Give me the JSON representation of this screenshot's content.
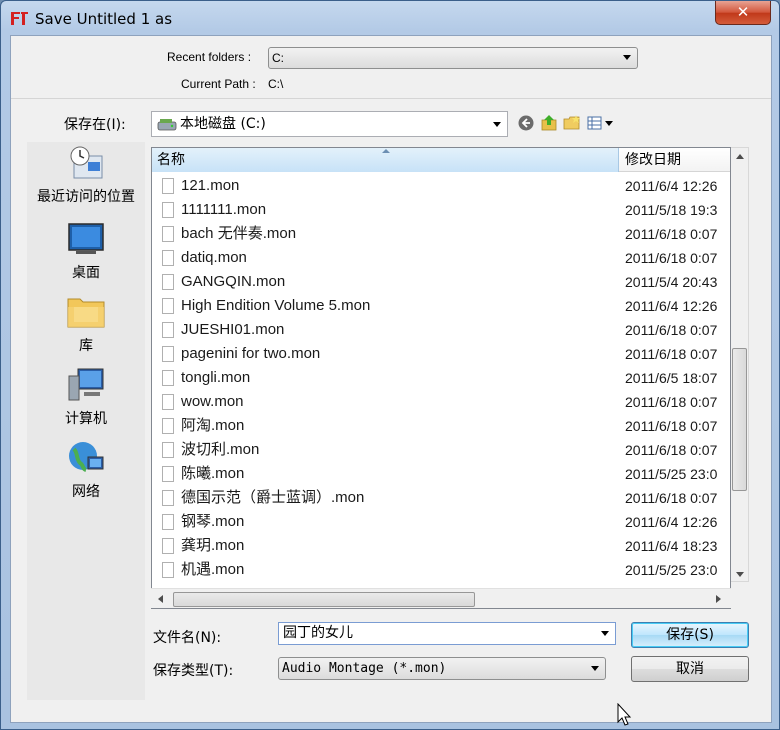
{
  "window": {
    "title": "Save Untitled 1 as",
    "close_label": "✕"
  },
  "top": {
    "recent_label": "Recent folders :",
    "recent_value": "C:",
    "current_path_label": "Current Path :",
    "current_path_value": "C:\\"
  },
  "savein": {
    "label": "保存在(I):",
    "value": "本地磁盘 (C:)"
  },
  "places": [
    {
      "label": "最近访问的位置",
      "icon": "recent-places-icon"
    },
    {
      "label": "桌面",
      "icon": "desktop-icon"
    },
    {
      "label": "库",
      "icon": "library-icon"
    },
    {
      "label": "计算机",
      "icon": "computer-icon"
    },
    {
      "label": "网络",
      "icon": "network-icon"
    }
  ],
  "columns": {
    "name": "名称",
    "date": "修改日期"
  },
  "files": [
    {
      "name": "121.mon",
      "date": "2011/6/4 12:26"
    },
    {
      "name": "1111111.mon",
      "date": "2011/5/18 19:3"
    },
    {
      "name": "bach 无伴奏.mon",
      "date": "2011/6/18 0:07"
    },
    {
      "name": "datiq.mon",
      "date": "2011/6/18 0:07"
    },
    {
      "name": "GANGQIN.mon",
      "date": "2011/5/4 20:43"
    },
    {
      "name": "High Endition Volume 5.mon",
      "date": "2011/6/4 12:26"
    },
    {
      "name": "JUESHI01.mon",
      "date": "2011/6/18 0:07"
    },
    {
      "name": "pagenini for two.mon",
      "date": "2011/6/18 0:07"
    },
    {
      "name": "tongli.mon",
      "date": "2011/6/5 18:07"
    },
    {
      "name": "wow.mon",
      "date": "2011/6/18 0:07"
    },
    {
      "name": "阿淘.mon",
      "date": "2011/6/18 0:07"
    },
    {
      "name": "波切利.mon",
      "date": "2011/6/18 0:07"
    },
    {
      "name": "陈曦.mon",
      "date": "2011/5/25 23:0"
    },
    {
      "name": "德国示范（爵士蓝调）.mon",
      "date": "2011/6/18 0:07"
    },
    {
      "name": "钢琴.mon",
      "date": "2011/6/4 12:26"
    },
    {
      "name": "龚玥.mon",
      "date": "2011/6/4 18:23"
    },
    {
      "name": "机遇.mon",
      "date": "2011/5/25 23:0"
    }
  ],
  "bottom": {
    "filename_label": "文件名(N):",
    "filename_value": "园丁的女儿",
    "filetype_label": "保存类型(T):",
    "filetype_value": "Audio Montage (*.mon)",
    "save_label": "保存(S)",
    "cancel_label": "取消"
  }
}
